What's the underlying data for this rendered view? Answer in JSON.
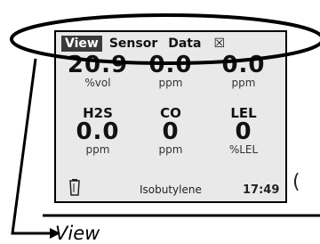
{
  "menu": {
    "items": [
      {
        "label": "View",
        "active": true
      },
      {
        "label": "Sensor",
        "active": false
      },
      {
        "label": "Data",
        "active": false
      }
    ],
    "close_icon": "☒"
  },
  "readings": {
    "row1": [
      {
        "value": "20.9",
        "unit": "%vol"
      },
      {
        "value": "0.0",
        "unit": "ppm"
      },
      {
        "value": "0.0",
        "unit": "ppm"
      }
    ],
    "row2": [
      {
        "name": "H2S",
        "value": "0.0",
        "unit": "ppm"
      },
      {
        "name": "CO",
        "value": "0",
        "unit": "ppm"
      },
      {
        "name": "LEL",
        "value": "0",
        "unit": "%LEL"
      }
    ]
  },
  "footer": {
    "battery_icon": "battery-icon",
    "gas_label": "Isobutylene",
    "time": "17:49"
  },
  "callout": {
    "label": "View",
    "side_mark": "("
  },
  "colors": {
    "screen_bg": "#e9e9e9",
    "active_tab_bg": "#3a3a3a",
    "outline": "#000000"
  }
}
